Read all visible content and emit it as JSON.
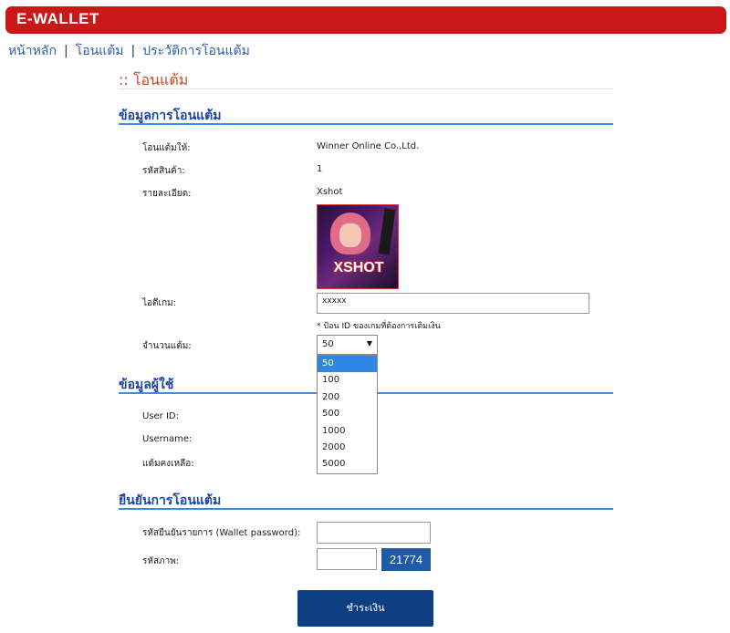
{
  "brand": "E-WALLET",
  "nav": {
    "home": "หน้าหลัก",
    "sep1": "|",
    "transfer": "โอนแต้ม",
    "sep2": "|",
    "history": "ประวัติการโอนแต้ม"
  },
  "page_title": ":: โอนแต้ม",
  "transfer_info": {
    "title": "ข้อมูลการโอนแต้ม",
    "to_label": "โอนแต้มให้:",
    "to_value": "Winner Online Co.,Ltd.",
    "product_code_label": "รหัสสินค้า:",
    "product_code_value": "1",
    "detail_label": "รายละเอียด:",
    "detail_value": "Xshot",
    "game_image_text": "XSHOT",
    "game_id_label": "ไอดีเกม:",
    "game_id_value": "xxxxx",
    "game_id_hint": "* ป้อน ID ของเกมที่ต้องการเติมเงิน",
    "amount_label": "จำนวนแต้ม:",
    "amount_selected": "50",
    "amount_options": [
      "50",
      "100",
      "200",
      "500",
      "1000",
      "2000",
      "5000"
    ]
  },
  "user_info": {
    "title": "ข้อมูลผู้ใช้",
    "userid_label": "User ID:",
    "username_label": "Username:",
    "balance_label": "แต้มคงเหลือ:"
  },
  "confirm": {
    "title": "ยืนยันการโอนแต้ม",
    "password_label": "รหัสยืนยันรายการ (Wallet password):",
    "captcha_label": "รหัสภาพ:",
    "captcha_code": "21774",
    "pay_button": "ชำระเงิน"
  },
  "colors": {
    "brand_red": "#cc1719",
    "section_blue": "#1a45a8",
    "rule_blue": "#3b8ee0",
    "button_navy": "#0e3f82",
    "selected_option": "#2f87e3"
  }
}
